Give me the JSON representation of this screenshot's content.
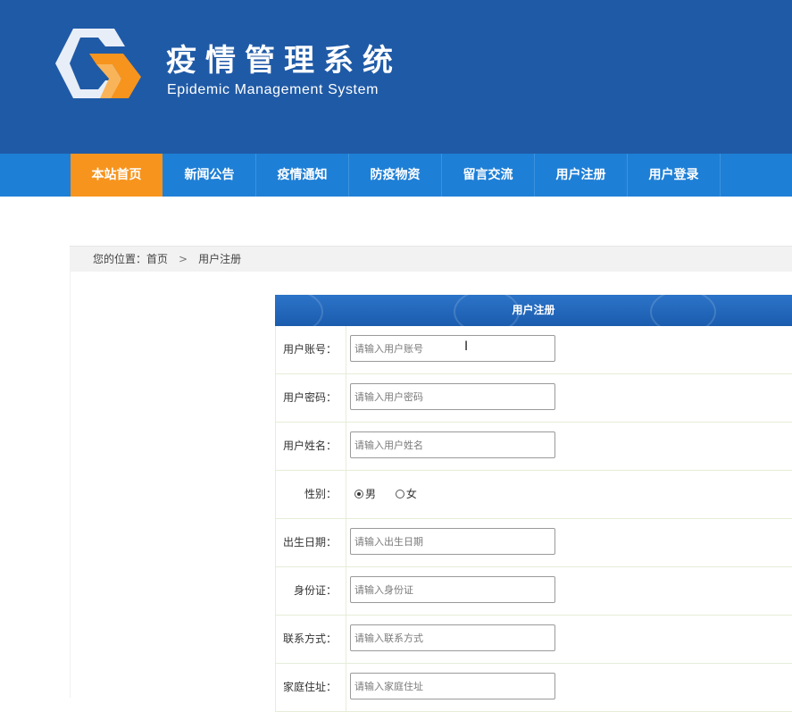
{
  "header": {
    "title": "疫情管理系统",
    "subtitle": "Epidemic Management System",
    "logo_icon": "logo-icon"
  },
  "nav": {
    "items": [
      {
        "label": "本站首页",
        "active": true
      },
      {
        "label": "新闻公告"
      },
      {
        "label": "疫情通知"
      },
      {
        "label": "防疫物资"
      },
      {
        "label": "留言交流"
      },
      {
        "label": "用户注册"
      },
      {
        "label": "用户登录"
      }
    ]
  },
  "breadcrumb": {
    "prefix": "您的位置：",
    "home": "首页",
    "separator": ">",
    "current": "用户注册"
  },
  "form": {
    "title": "用户注册",
    "fields": [
      {
        "label": "用户账号：",
        "placeholder": "请输入用户账号"
      },
      {
        "label": "用户密码：",
        "placeholder": "请输入用户密码"
      },
      {
        "label": "用户姓名：",
        "placeholder": "请输入用户姓名"
      },
      {
        "label": "性别：",
        "options": [
          "男",
          "女"
        ],
        "selected": "男"
      },
      {
        "label": "出生日期：",
        "placeholder": "请输入出生日期"
      },
      {
        "label": "身份证：",
        "placeholder": "请输入身份证"
      },
      {
        "label": "联系方式：",
        "placeholder": "请输入联系方式"
      },
      {
        "label": "家庭住址：",
        "placeholder": "请输入家庭住址"
      }
    ]
  },
  "colors": {
    "header_bg": "#1f5aa6",
    "nav_bg": "#1e7fd6",
    "nav_active": "#f7941d"
  }
}
